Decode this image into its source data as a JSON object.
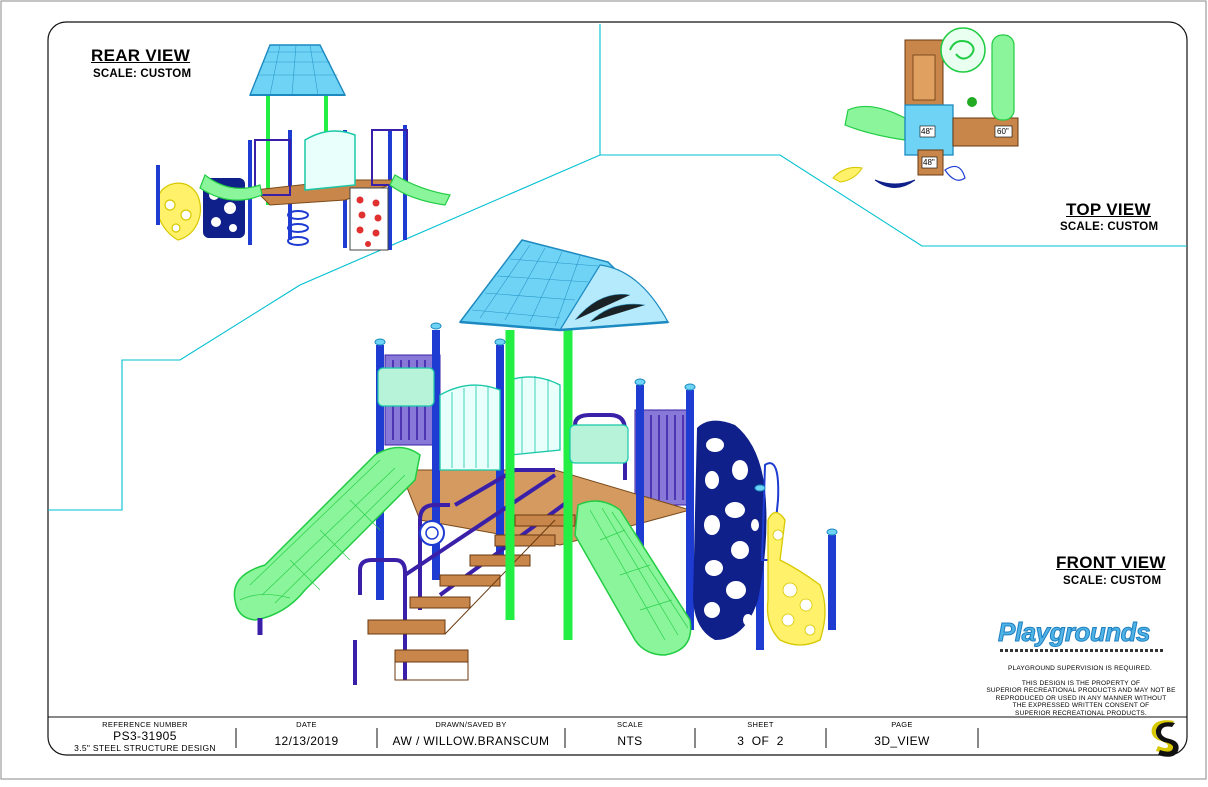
{
  "views": {
    "rear": {
      "title": "REAR VIEW",
      "scale": "SCALE: CUSTOM"
    },
    "top": {
      "title": "TOP VIEW",
      "scale": "SCALE: CUSTOM",
      "deck_heights": [
        "48\"",
        "60\"",
        "48\""
      ]
    },
    "front": {
      "title": "FRONT VIEW",
      "scale": "SCALE: CUSTOM"
    }
  },
  "branding": {
    "logo_text": "Playgrounds",
    "supervision_note": "PLAYGROUND SUPERVISION IS REQUIRED.",
    "property_note": [
      "THIS DESIGN IS THE PROPERTY OF",
      "SUPERIOR RECREATIONAL PRODUCTS AND MAY NOT BE",
      "REPRODUCED OR USED IN ANY MANNER WITHOUT",
      "THE EXPRESSED WRITTEN CONSENT OF",
      "SUPERIOR RECREATIONAL PRODUCTS."
    ],
    "corner_logo": "S"
  },
  "title_block": {
    "reference_label": "REFERENCE NUMBER",
    "reference_number": "PS3-31905",
    "reference_desc": "3.5\" STEEL STRUCTURE DESIGN",
    "date_label": "DATE",
    "date": "12/13/2019",
    "drawn_label": "DRAWN/SAVED BY",
    "drawn_by": "AW / WILLOW.BRANSCUM",
    "scale_label": "SCALE",
    "scale": "NTS",
    "sheet_label": "SHEET",
    "sheet": "3  OF  2",
    "page_label": "PAGE",
    "page": "3D_VIEW"
  },
  "colors": {
    "frame_cyan": "#00c0d0",
    "slide_green": "#22ee44",
    "post_blue": "#1e3cd2",
    "rail_purple": "#3a1fa8",
    "roof_cyan": "#37b8e8",
    "deck_brown": "#c8864a",
    "climber_yellow": "#f2e200",
    "navy": "#10208a",
    "rock_red": "#e03030"
  }
}
